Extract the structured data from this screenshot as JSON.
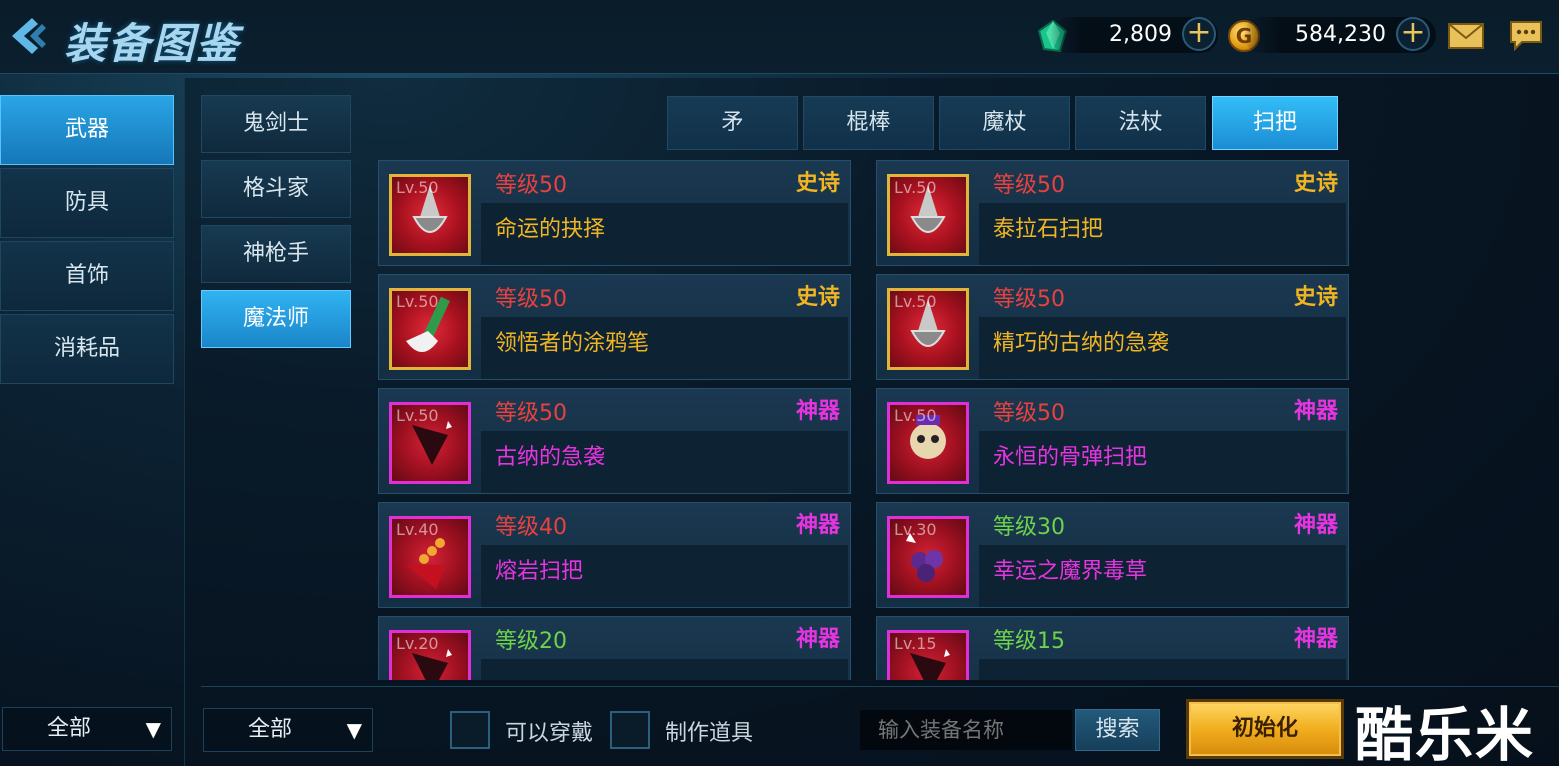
{
  "header": {
    "title": "装备图鉴",
    "gems": "2,809",
    "gold": "584,230",
    "gold_icon_letter": "G"
  },
  "categories": [
    {
      "label": "武器",
      "active": true
    },
    {
      "label": "防具",
      "active": false
    },
    {
      "label": "首饰",
      "active": false
    },
    {
      "label": "消耗品",
      "active": false
    }
  ],
  "classes": [
    {
      "label": "鬼剑士",
      "active": false
    },
    {
      "label": "格斗家",
      "active": false
    },
    {
      "label": "神枪手",
      "active": false
    },
    {
      "label": "魔法师",
      "active": true
    }
  ],
  "weapon_types": [
    {
      "label": "矛",
      "active": false
    },
    {
      "label": "棍棒",
      "active": false
    },
    {
      "label": "魔杖",
      "active": false
    },
    {
      "label": "法杖",
      "active": false
    },
    {
      "label": "扫把",
      "active": true
    }
  ],
  "items": [
    {
      "lv": "Lv.50",
      "level": "等级50",
      "level_color": "red",
      "rarity": "史诗",
      "rarity_type": "epic",
      "name": "命运的抉择",
      "icon": "broom-epic-icon"
    },
    {
      "lv": "Lv.50",
      "level": "等级50",
      "level_color": "red",
      "rarity": "史诗",
      "rarity_type": "epic",
      "name": "泰拉石扫把",
      "icon": "broom-epic-icon"
    },
    {
      "lv": "Lv.50",
      "level": "等级50",
      "level_color": "red",
      "rarity": "史诗",
      "rarity_type": "epic",
      "name": "领悟者的涂鸦笔",
      "icon": "brush-epic-icon"
    },
    {
      "lv": "Lv.50",
      "level": "等级50",
      "level_color": "red",
      "rarity": "史诗",
      "rarity_type": "epic",
      "name": "精巧的古纳的急袭",
      "icon": "broom-epic-icon"
    },
    {
      "lv": "Lv.50",
      "level": "等级50",
      "level_color": "red",
      "rarity": "神器",
      "rarity_type": "artifact",
      "name": "古纳的急袭",
      "icon": "broom-artifact-icon"
    },
    {
      "lv": "Lv.50",
      "level": "等级50",
      "level_color": "red",
      "rarity": "神器",
      "rarity_type": "artifact",
      "name": "永恒的骨弹扫把",
      "icon": "skull-broom-artifact-icon"
    },
    {
      "lv": "Lv.40",
      "level": "等级40",
      "level_color": "red",
      "rarity": "神器",
      "rarity_type": "artifact",
      "name": "熔岩扫把",
      "icon": "lava-broom-artifact-icon"
    },
    {
      "lv": "Lv.30",
      "level": "等级30",
      "level_color": "green",
      "rarity": "神器",
      "rarity_type": "artifact",
      "name": "幸运之魔界毒草",
      "icon": "berry-broom-artifact-icon"
    },
    {
      "lv": "Lv.20",
      "level": "等级20",
      "level_color": "green",
      "rarity": "神器",
      "rarity_type": "artifact",
      "name": "",
      "icon": "broom-artifact-icon"
    },
    {
      "lv": "Lv.15",
      "level": "等级15",
      "level_color": "green",
      "rarity": "神器",
      "rarity_type": "artifact",
      "name": "",
      "icon": "broom-artifact-icon"
    }
  ],
  "bottom": {
    "left_filter": "全部",
    "class_filter": "全部",
    "wearable_label": "可以穿戴",
    "craft_label": "制作道具",
    "search_placeholder": "输入装备名称",
    "search_button": "搜索",
    "reset_button": "初始化"
  },
  "watermark": "酷乐米",
  "colors": {
    "accent_blue": "#1b8dd3",
    "epic": "#f1b523",
    "artifact": "#e534e0",
    "level_red": "#e8413f",
    "level_green": "#6dd34a",
    "gold_button": "#f1ae1e"
  }
}
